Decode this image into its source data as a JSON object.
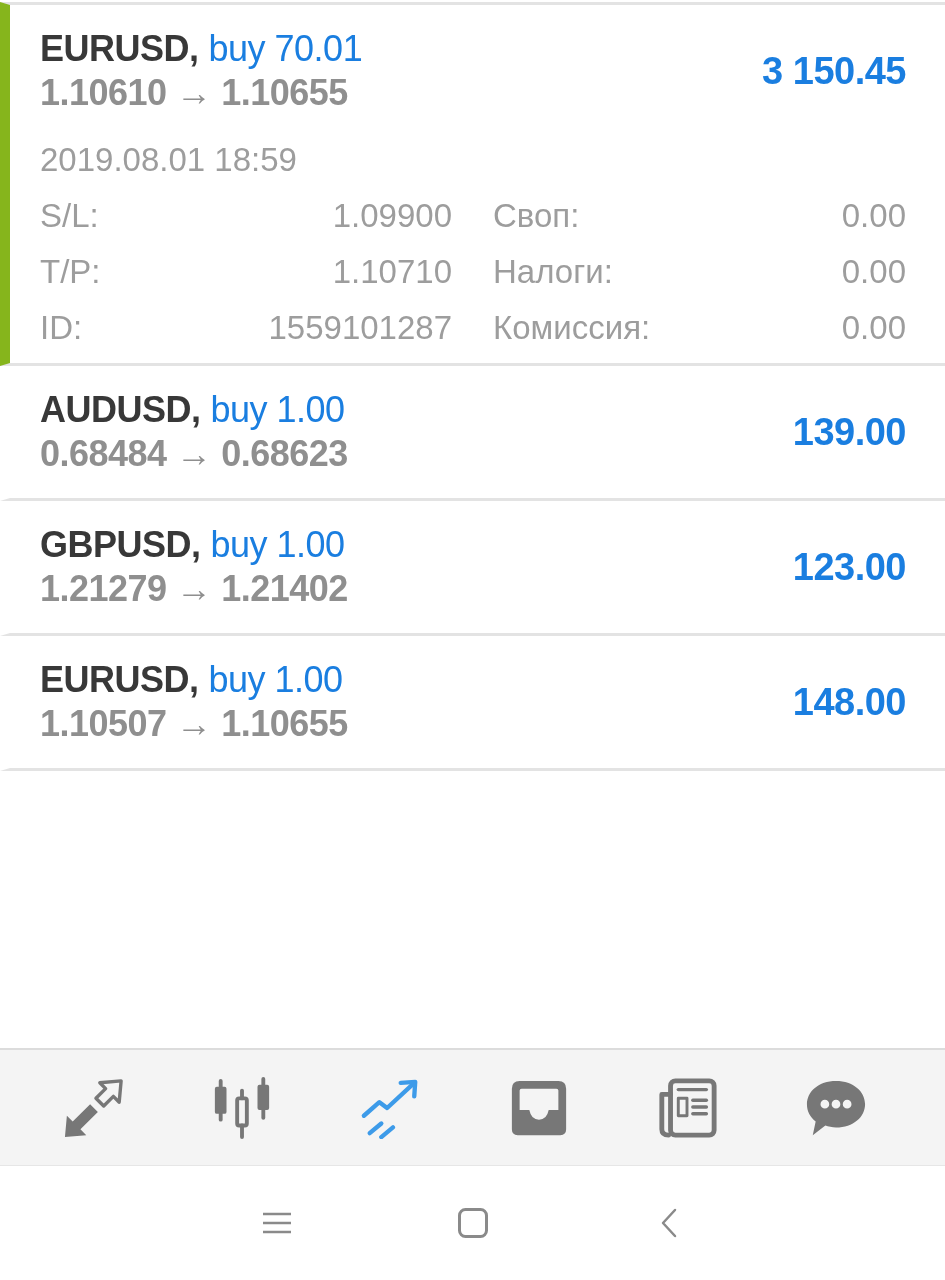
{
  "positions": [
    {
      "symbol": "EURUSD,",
      "order": "buy 70.01",
      "prices": "1.10610 → 1.10655",
      "profit": "3 150.45",
      "selected": true,
      "time": "2019.08.01 18:59",
      "details": [
        {
          "label": "S/L:",
          "value": "1.09900"
        },
        {
          "label": "Своп:",
          "value": "0.00"
        },
        {
          "label": "T/P:",
          "value": "1.10710"
        },
        {
          "label": "Налоги:",
          "value": "0.00"
        },
        {
          "label": "ID:",
          "value": "1559101287"
        },
        {
          "label": "Комиссия:",
          "value": "0.00"
        }
      ]
    },
    {
      "symbol": "AUDUSD,",
      "order": "buy 1.00",
      "prices": "0.68484 → 0.68623",
      "profit": "139.00",
      "selected": false
    },
    {
      "symbol": "GBPUSD,",
      "order": "buy 1.00",
      "prices": "1.21279 → 1.21402",
      "profit": "123.00",
      "selected": false
    },
    {
      "symbol": "EURUSD,",
      "order": "buy 1.00",
      "prices": "1.10507 → 1.10655",
      "profit": "148.00",
      "selected": false
    }
  ],
  "tab_bar": [
    {
      "kind": "arrows",
      "selected": false
    },
    {
      "kind": "candlesticks",
      "selected": false
    },
    {
      "kind": "trend",
      "selected": true
    },
    {
      "kind": "inbox",
      "selected": false
    },
    {
      "kind": "newspaper",
      "selected": false
    },
    {
      "kind": "chat",
      "selected": false
    }
  ]
}
